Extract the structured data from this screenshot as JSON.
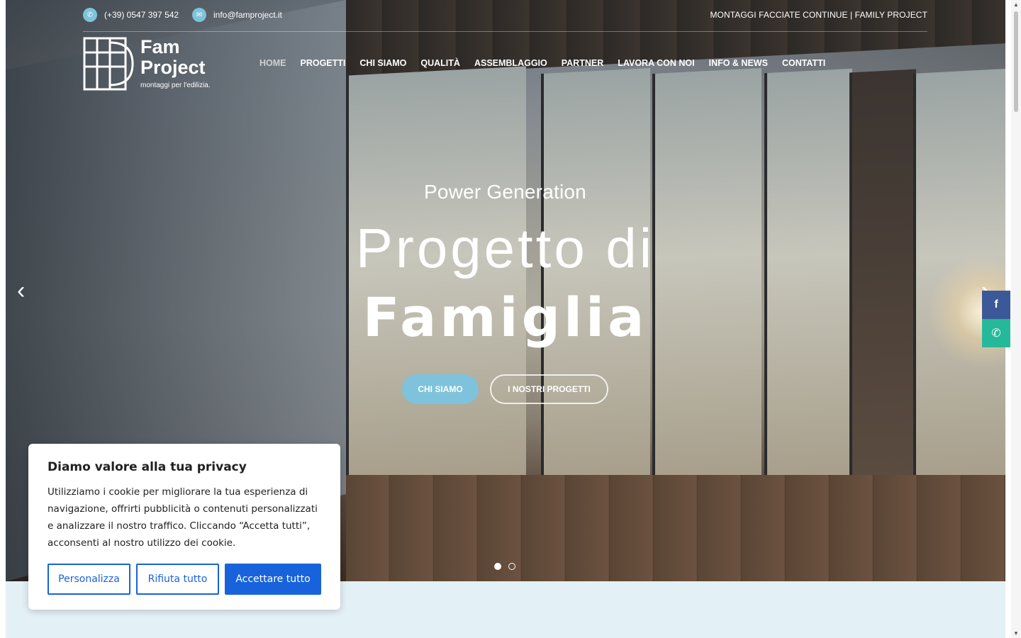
{
  "topbar": {
    "phone": "(+39) 0547 397 542",
    "email": "info@famproject.it",
    "tagline": "MONTAGGI FACCIATE CONTINUE | FAMILY PROJECT"
  },
  "logo": {
    "name_line1": "Fam",
    "name_line2": "Project",
    "tagline": "montaggi per l'edilizia."
  },
  "nav": {
    "items": [
      {
        "label": "HOME",
        "active": true
      },
      {
        "label": "PROGETTI"
      },
      {
        "label": "CHI SIAMO"
      },
      {
        "label": "QUALITÀ"
      },
      {
        "label": "ASSEMBLAGGIO"
      },
      {
        "label": "PARTNER"
      },
      {
        "label": "LAVORA CON NOI"
      },
      {
        "label": "INFO & NEWS"
      },
      {
        "label": "CONTATTI"
      }
    ]
  },
  "hero": {
    "subtitle": "Power Generation",
    "title_line1": "Progetto di",
    "title_line2": "Famiglia",
    "btn_primary": "CHI SIAMO",
    "btn_secondary": "I NOSTRI PROGETTI",
    "arrow_left": "‹",
    "arrow_right": "›",
    "slide_count": 2,
    "active_slide": 1
  },
  "social": {
    "facebook_glyph": "f",
    "whatsapp_glyph": "✆"
  },
  "icons": {
    "phone": "phone-icon",
    "email": "mail-icon"
  },
  "cookie": {
    "title": "Diamo valore alla tua privacy",
    "body": "Utilizziamo i cookie per migliorare la tua esperienza di navigazione, offrirti pubblicità o contenuti personalizzati e analizzare il nostro traffico. Cliccando “Accetta tutti”, acconsenti al nostro utilizzo dei cookie.",
    "btn_customize": "Personalizza",
    "btn_reject": "Rifiuta tutto",
    "btn_accept": "Accettare tutto"
  },
  "colors": {
    "accent": "#7ec3db",
    "cookie_blue": "#1863dc",
    "facebook": "#3b5998",
    "whatsapp": "#25b99a",
    "section_bg": "#e3f0f6"
  }
}
